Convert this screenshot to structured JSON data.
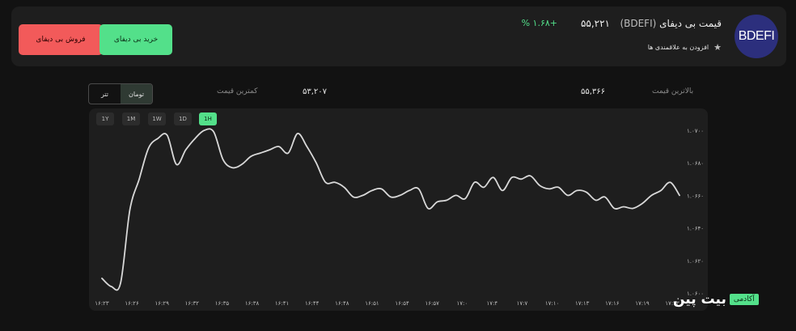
{
  "actions": {
    "sell_label": "فروش بی دیفای",
    "buy_label": "خرید بی دیفای"
  },
  "coin": {
    "logo_text": "BDEFI",
    "name": "قیمت بی دیفای",
    "symbol": "(BDEFI)",
    "price": "۵۵,۲۲۱",
    "change": "+۱.۶۸ %",
    "favorite_label": "افزودن به علاقمندی ها"
  },
  "stats": {
    "high_label": "بالاترین قیمت",
    "high_value": "۵۵,۳۶۶",
    "low_label": "کمترین قیمت",
    "low_value": "۵۳,۲۰۷"
  },
  "currency_toggle": {
    "options": [
      "تومان",
      "تتر"
    ],
    "selected": "تومان"
  },
  "ranges": {
    "items": [
      "1Y",
      "1M",
      "1W",
      "1D",
      "1H"
    ],
    "selected": "1H"
  },
  "watermark": {
    "badge": "آکادمی",
    "text": "بیت پین"
  },
  "colors": {
    "accent": "#53e08a",
    "danger": "#f25a5a",
    "line": "#d8d8d8"
  },
  "chart_data": {
    "type": "line",
    "y_tick_labels": [
      "۱.۰۷۰۰",
      "۱.۰۶۸۰",
      "۱.۰۶۶۰",
      "۱.۰۶۴۰",
      "۱.۰۶۲۰",
      "۱.۰۶۰۰"
    ],
    "y_ticks": [
      1.07,
      1.068,
      1.066,
      1.064,
      1.062,
      1.06
    ],
    "ylim": [
      1.06,
      1.07
    ],
    "x_tick_labels": [
      "۱۶:۲۳",
      "۱۶:۲۶",
      "۱۶:۲۹",
      "۱۶:۳۲",
      "۱۶:۳۵",
      "۱۶:۳۸",
      "۱۶:۴۱",
      "۱۶:۴۴",
      "۱۶:۴۸",
      "۱۶:۵۱",
      "۱۶:۵۴",
      "۱۶:۵۷",
      "۱۷:۰",
      "۱۷:۴",
      "۱۷:۷",
      "۱۷:۱۰",
      "۱۷:۱۳",
      "۱۷:۱۶",
      "۱۷:۱۹",
      "۱۷:۲۳"
    ],
    "series": [
      {
        "values": [
          1.0609,
          1.0604,
          1.0606,
          1.0651,
          1.067,
          1.0689,
          1.0695,
          1.0697,
          1.0679,
          1.0688,
          1.0695,
          1.07,
          1.0699,
          1.0682,
          1.0677,
          1.0679,
          1.0684,
          1.0686,
          1.0688,
          1.069,
          1.0686,
          1.0698,
          1.069,
          1.068,
          1.0668,
          1.0668,
          1.0665,
          1.0659,
          1.066,
          1.0663,
          1.0664,
          1.0659,
          1.066,
          1.0663,
          1.0664,
          1.0652,
          1.0656,
          1.0657,
          1.066,
          1.0658,
          1.0668,
          1.0665,
          1.0671,
          1.0663,
          1.0671,
          1.067,
          1.0672,
          1.0666,
          1.0664,
          1.0665,
          1.066,
          1.0663,
          1.0662,
          1.0657,
          1.0659,
          1.0652,
          1.0653,
          1.0652,
          1.0655,
          1.066,
          1.0663,
          1.0668,
          1.066
        ]
      }
    ]
  }
}
